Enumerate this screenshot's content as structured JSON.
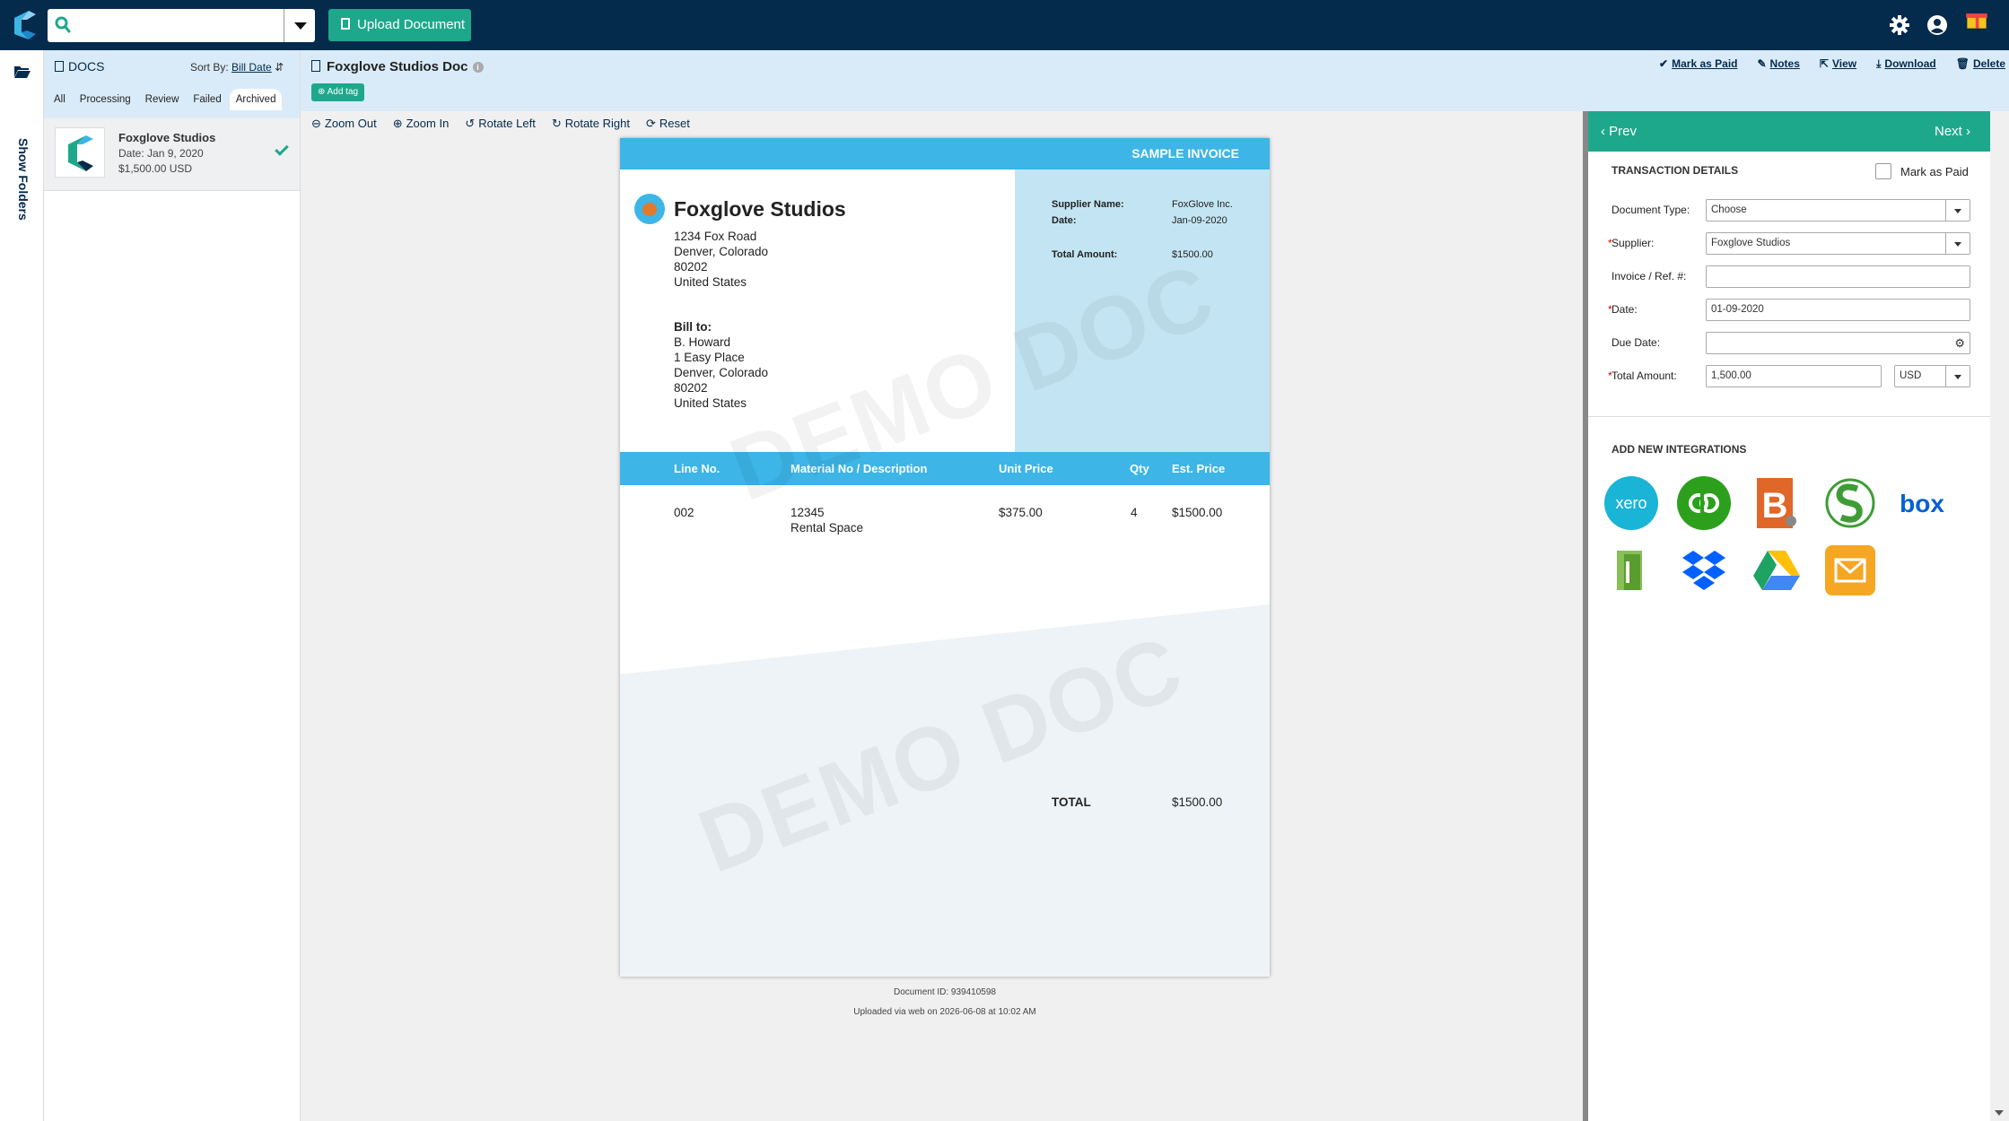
{
  "topbar": {
    "search_placeholder": "",
    "upload_label": "Upload Document",
    "accent": "#1ea88b",
    "navy": "#042a4c"
  },
  "leftrail": {
    "show_folders": "Show Folders"
  },
  "docs": {
    "title": "DOCS",
    "sort_by_label": "Sort By:",
    "sort_by_value": "Bill Date",
    "tabs": [
      "All",
      "Processing",
      "Review",
      "Failed",
      "Archived"
    ],
    "active_tab": "Archived",
    "items": [
      {
        "title": "Foxglove Studios",
        "date": "Date: Jan 9, 2020",
        "amount": "$1,500.00 USD"
      }
    ]
  },
  "document": {
    "title": "Foxglove Studios Doc",
    "add_tag": "Add tag",
    "actions": [
      "Mark as Paid",
      "Notes",
      "View",
      "Download",
      "Delete"
    ]
  },
  "toolbar": [
    "Zoom Out",
    "Zoom In",
    "Rotate Left",
    "Rotate Right",
    "Reset"
  ],
  "invoice": {
    "header": "SAMPLE INVOICE",
    "company": "Foxglove Studios",
    "address": [
      "1234 Fox Road",
      "Denver, Colorado",
      "80202",
      "United States"
    ],
    "bill_to_label": "Bill to:",
    "bill_to": [
      "B. Howard",
      "1 Easy Place",
      "Denver, Colorado",
      "80202",
      "United States"
    ],
    "supplier_label": "Supplier Name:",
    "supplier_value": "FoxGlove Inc.",
    "date_label": "Date:",
    "date_value": "Jan-09-2020",
    "total_amount_label": "Total Amount:",
    "total_amount_value": "$1500.00",
    "columns": [
      "Line No.",
      "Material No / Description",
      "Unit Price",
      "Qty",
      "Est. Price"
    ],
    "rows": [
      {
        "line": "002",
        "material": "12345",
        "description": "Rental Space",
        "unit_price": "$375.00",
        "qty": "4",
        "est_price": "$1500.00"
      }
    ],
    "total_label": "TOTAL",
    "total_value": "$1500.00",
    "watermark": "DEMO DOC"
  },
  "footer": {
    "doc_id": "Document ID: 939410598",
    "uploaded": "Uploaded via web on 2026-06-08 at 10:02 AM"
  },
  "panel": {
    "prev": "Prev",
    "next": "Next",
    "section_title": "TRANSACTION DETAILS",
    "mark_as_paid": "Mark as Paid",
    "fields": {
      "doc_type_label": "Document Type:",
      "doc_type_value": "Choose",
      "supplier_label": "Supplier:",
      "supplier_value": "Foxglove Studios",
      "invoice_label": "Invoice / Ref. #:",
      "invoice_value": "",
      "date_label": "Date:",
      "date_value": "01-09-2020",
      "due_date_label": "Due Date:",
      "due_date_value": "",
      "total_label": "Total Amount:",
      "total_value": "1,500.00",
      "currency": "USD"
    },
    "required_mark": "*",
    "integrations_title": "ADD NEW INTEGRATIONS",
    "integrations": [
      "xero",
      "quickbooks",
      "bill",
      "sage",
      "box",
      "green-book",
      "dropbox",
      "google-drive",
      "email"
    ]
  }
}
